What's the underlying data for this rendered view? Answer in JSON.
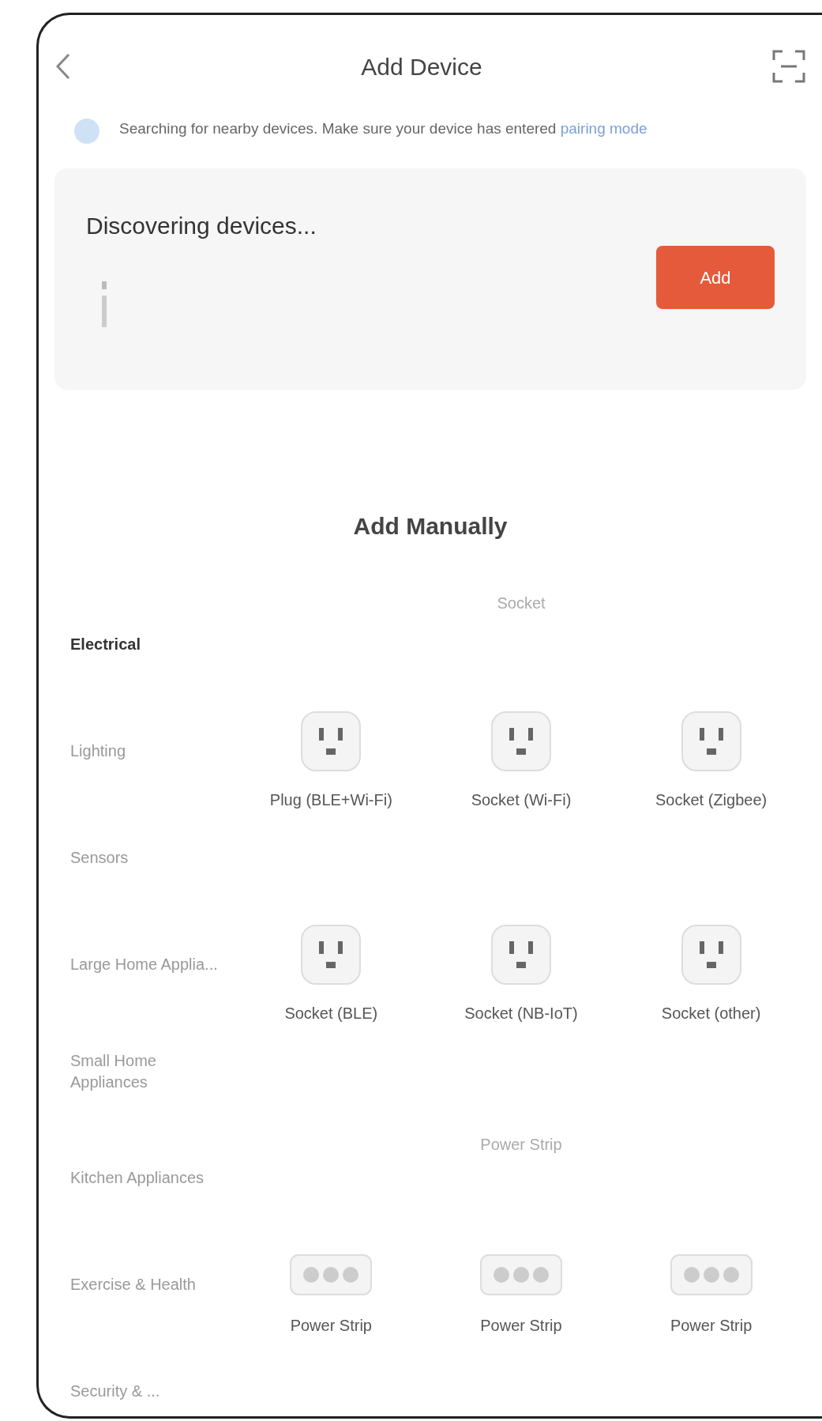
{
  "header": {
    "title": "Add Device"
  },
  "notice": {
    "text": "Searching for nearby devices. Make sure your device has entered ",
    "link": "pairing mode"
  },
  "discovery": {
    "title": "Discovering devices...",
    "button": "Add"
  },
  "manual": {
    "title": "Add Manually",
    "categories": [
      {
        "label": "Electrical",
        "selected": true
      },
      {
        "label": "Lighting",
        "selected": false
      },
      {
        "label": "Sensors",
        "selected": false
      },
      {
        "label": "Large Home Applia...",
        "selected": false
      },
      {
        "label": "Small Home Appliances",
        "selected": false
      },
      {
        "label": "Kitchen Appliances",
        "selected": false
      },
      {
        "label": "Exercise & Health",
        "selected": false
      },
      {
        "label": "Security & ...",
        "selected": false
      }
    ],
    "groups": [
      {
        "title": "Socket",
        "items": [
          {
            "label": "Plug (BLE+Wi-Fi)",
            "kind": "socket"
          },
          {
            "label": "Socket (Wi-Fi)",
            "kind": "socket"
          },
          {
            "label": "Socket (Zigbee)",
            "kind": "socket"
          },
          {
            "label": "Socket (BLE)",
            "kind": "socket"
          },
          {
            "label": "Socket (NB-IoT)",
            "kind": "socket"
          },
          {
            "label": "Socket (other)",
            "kind": "socket"
          }
        ]
      },
      {
        "title": "Power Strip",
        "items": [
          {
            "label": "Power Strip",
            "kind": "strip"
          },
          {
            "label": "Power Strip",
            "kind": "strip"
          },
          {
            "label": "Power Strip",
            "kind": "strip"
          }
        ]
      }
    ]
  }
}
